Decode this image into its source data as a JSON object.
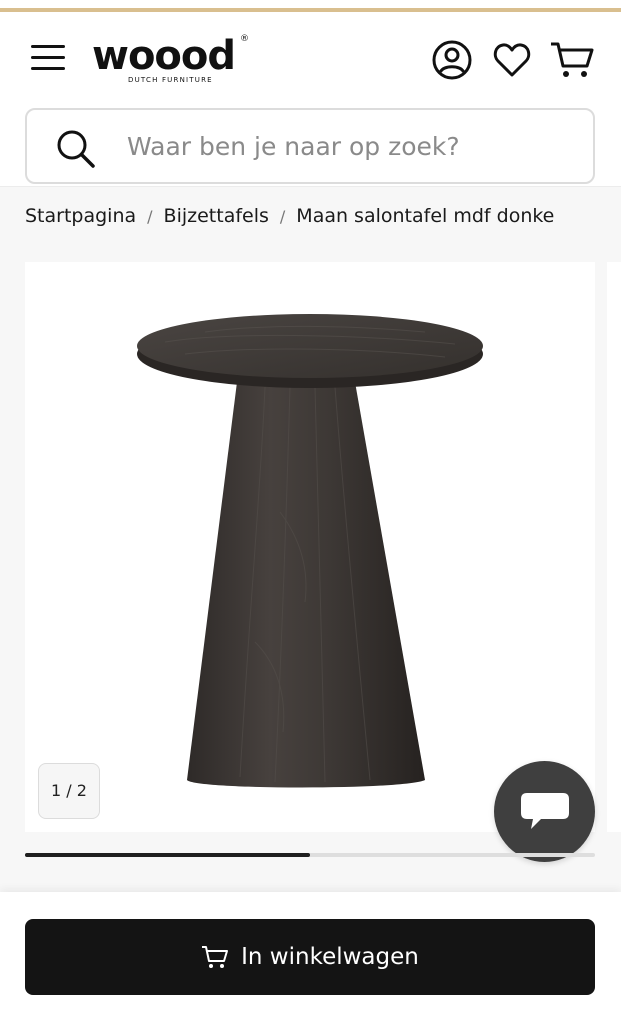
{
  "header": {
    "menu_icon": "hamburger-menu-icon",
    "logo": {
      "wordmark": "woood",
      "registered": "®",
      "tagline": "DUTCH FURNITURE"
    },
    "icons": [
      "account-icon",
      "heart-icon",
      "cart-icon"
    ]
  },
  "search": {
    "placeholder": "Waar ben je naar op zoek?",
    "value": "",
    "icon": "search-icon"
  },
  "breadcrumb": {
    "items": [
      "Startpagina",
      "Bijzettafels",
      "Maan salontafel mdf donke"
    ],
    "separator": "/"
  },
  "gallery": {
    "counter": "1 / 2",
    "current": 1,
    "total": 2,
    "progress": 0.5
  },
  "chat": {
    "icon": "chat-bubble-icon"
  },
  "cta": {
    "label": "In winkelwagen",
    "icon": "cart-icon"
  },
  "colors": {
    "accent": "#d9bf8f",
    "button": "#141414",
    "chat": "#3f3f3f",
    "table": "#3b3634"
  }
}
